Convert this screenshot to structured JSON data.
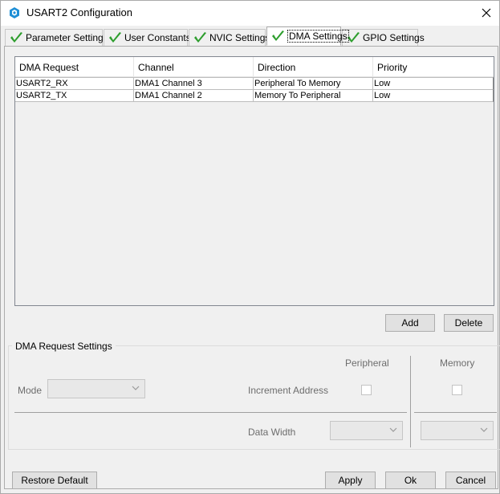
{
  "window": {
    "title": "USART2 Configuration"
  },
  "tabs": [
    {
      "label": "Parameter Settings"
    },
    {
      "label": "User Constants"
    },
    {
      "label": "NVIC Settings"
    },
    {
      "label": "DMA Settings"
    },
    {
      "label": "GPIO Settings"
    }
  ],
  "active_tab": "DMA Settings",
  "table": {
    "headers": [
      "DMA Request",
      "Channel",
      "Direction",
      "Priority"
    ],
    "rows": [
      [
        "USART2_RX",
        "DMA1 Channel 3",
        "Peripheral To Memory",
        "Low"
      ],
      [
        "USART2_TX",
        "DMA1 Channel 2",
        "Memory To Peripheral",
        "Low"
      ]
    ]
  },
  "buttons": {
    "add": "Add",
    "delete": "Delete",
    "restore": "Restore Default",
    "apply": "Apply",
    "ok": "Ok",
    "cancel": "Cancel"
  },
  "dma_request_settings": {
    "title": "DMA Request Settings",
    "peripheral_header": "Peripheral",
    "memory_header": "Memory",
    "mode_label": "Mode",
    "increment_label": "Increment Address",
    "data_width_label": "Data Width",
    "mode_value": "",
    "peripheral_data_width": "",
    "memory_data_width": "",
    "peripheral_increment": false,
    "memory_increment": false
  },
  "colors": {
    "check_green": "#2e9e2e",
    "app_icon_blue": "#1e8fd6"
  }
}
